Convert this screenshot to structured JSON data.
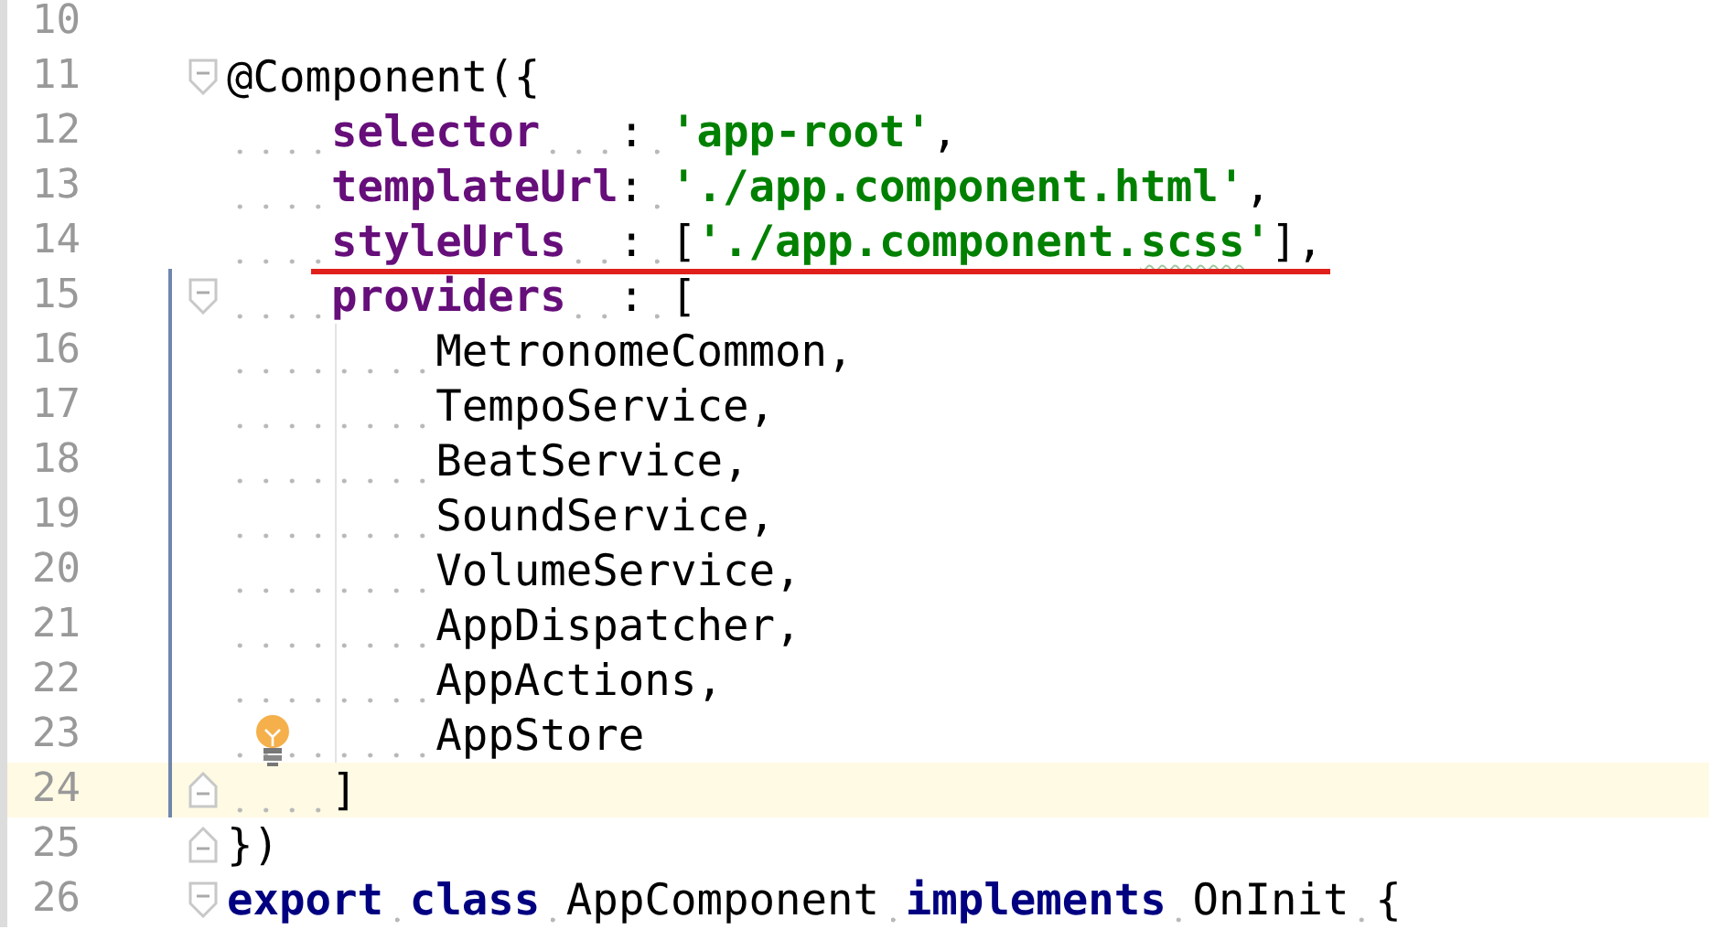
{
  "lines": [
    {
      "number": "10"
    },
    {
      "number": "11",
      "fold_start": true,
      "tokens": [
        {
          "kind": "plain",
          "text": "@Component({"
        }
      ]
    },
    {
      "number": "12",
      "tokens": [
        {
          "kind": "property",
          "text": "    selector"
        },
        {
          "kind": "plain",
          "text": "   : "
        },
        {
          "kind": "string",
          "text": "'app-root'"
        },
        {
          "kind": "plain",
          "text": ","
        }
      ]
    },
    {
      "number": "13",
      "tokens": [
        {
          "kind": "property",
          "text": "    templateUrl"
        },
        {
          "kind": "plain",
          "text": ": "
        },
        {
          "kind": "string",
          "text": "'./app.component.html'"
        },
        {
          "kind": "plain",
          "text": ","
        }
      ]
    },
    {
      "number": "14",
      "underline": true,
      "tokens": [
        {
          "kind": "property",
          "text": "    styleUrls"
        },
        {
          "kind": "plain",
          "text": "  : ["
        },
        {
          "kind": "string",
          "text": "'./app.component."
        },
        {
          "kind": "string",
          "text": "scss",
          "squiggle": true
        },
        {
          "kind": "string",
          "text": "'"
        },
        {
          "kind": "plain",
          "text": "],"
        }
      ]
    },
    {
      "number": "15",
      "fold_start": true,
      "changed": true,
      "tokens": [
        {
          "kind": "property",
          "text": "    providers"
        },
        {
          "kind": "plain",
          "text": "  : ["
        }
      ]
    },
    {
      "number": "16",
      "changed": true,
      "tokens": [
        {
          "kind": "plain",
          "text": "        MetronomeCommon,"
        }
      ]
    },
    {
      "number": "17",
      "changed": true,
      "tokens": [
        {
          "kind": "plain",
          "text": "        TempoService,"
        }
      ]
    },
    {
      "number": "18",
      "changed": true,
      "tokens": [
        {
          "kind": "plain",
          "text": "        BeatService,"
        }
      ]
    },
    {
      "number": "19",
      "changed": true,
      "tokens": [
        {
          "kind": "plain",
          "text": "        SoundService,"
        }
      ]
    },
    {
      "number": "20",
      "changed": true,
      "tokens": [
        {
          "kind": "plain",
          "text": "        VolumeService,"
        }
      ]
    },
    {
      "number": "21",
      "changed": true,
      "tokens": [
        {
          "kind": "plain",
          "text": "        AppDispatcher,"
        }
      ]
    },
    {
      "number": "22",
      "changed": true,
      "tokens": [
        {
          "kind": "plain",
          "text": "        AppActions,"
        }
      ]
    },
    {
      "number": "23",
      "changed": true,
      "bulb": true,
      "tokens": [
        {
          "kind": "plain",
          "text": "        AppStore"
        }
      ]
    },
    {
      "number": "24",
      "fold_end": true,
      "changed": true,
      "current": true,
      "tokens": [
        {
          "kind": "plain",
          "text": "    ]"
        }
      ]
    },
    {
      "number": "25",
      "fold_end": true,
      "tokens": [
        {
          "kind": "plain",
          "text": "})"
        }
      ]
    },
    {
      "number": "26",
      "fold_start": true,
      "tokens": [
        {
          "kind": "keyword",
          "text": "export "
        },
        {
          "kind": "keyword",
          "text": "class"
        },
        {
          "kind": "plain",
          "text": " AppComponent "
        },
        {
          "kind": "keyword",
          "text": "implements"
        },
        {
          "kind": "plain",
          "text": " OnInit {"
        }
      ]
    }
  ]
}
